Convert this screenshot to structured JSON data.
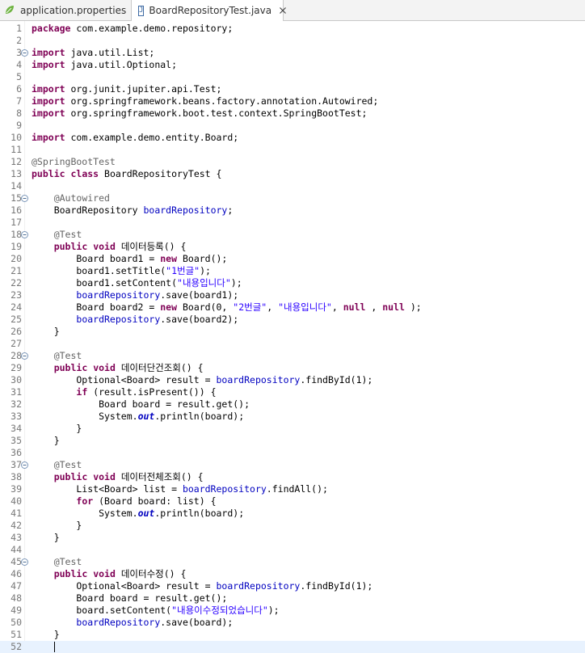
{
  "tabs": [
    {
      "label": "application.properties",
      "icon": "leaf-icon",
      "active": false
    },
    {
      "label": "BoardRepositoryTest.java",
      "icon": "java-file-icon",
      "active": true
    }
  ],
  "colors": {
    "keyword": "#7f0055",
    "annotation": "#646464",
    "string": "#2a00ff",
    "field": "#0000c0",
    "current_line": "#e8f2fe",
    "line_number": "#787878"
  },
  "editor": {
    "current_line": 52,
    "lines": [
      {
        "n": "1",
        "fold": false,
        "tokens": [
          [
            "kw",
            "package"
          ],
          [
            "",
            "com.example.demo.repository;"
          ]
        ]
      },
      {
        "n": "2",
        "fold": false,
        "tokens": []
      },
      {
        "n": "3",
        "fold": true,
        "tokens": [
          [
            "kw",
            "import"
          ],
          [
            "",
            "java.util.List;"
          ]
        ]
      },
      {
        "n": "4",
        "fold": false,
        "tokens": [
          [
            "kw",
            "import"
          ],
          [
            "",
            "java.util.Optional;"
          ]
        ]
      },
      {
        "n": "5",
        "fold": false,
        "tokens": []
      },
      {
        "n": "6",
        "fold": false,
        "tokens": [
          [
            "kw",
            "import"
          ],
          [
            "",
            "org.junit.jupiter.api.Test;"
          ]
        ]
      },
      {
        "n": "7",
        "fold": false,
        "tokens": [
          [
            "kw",
            "import"
          ],
          [
            "",
            "org.springframework.beans.factory.annotation.Autowired;"
          ]
        ]
      },
      {
        "n": "8",
        "fold": false,
        "tokens": [
          [
            "kw",
            "import"
          ],
          [
            "",
            "org.springframework.boot.test.context.SpringBootTest;"
          ]
        ]
      },
      {
        "n": "9",
        "fold": false,
        "tokens": []
      },
      {
        "n": "10",
        "fold": false,
        "tokens": [
          [
            "kw",
            "import"
          ],
          [
            "",
            "com.example.demo.entity.Board;"
          ]
        ]
      },
      {
        "n": "11",
        "fold": false,
        "tokens": []
      },
      {
        "n": "12",
        "fold": false,
        "tokens": [
          [
            "an",
            "@SpringBootTest"
          ]
        ]
      },
      {
        "n": "13",
        "fold": false,
        "tokens": [
          [
            "kw",
            "public"
          ],
          [
            "kw",
            "class"
          ],
          [
            "",
            "BoardRepositoryTest {"
          ]
        ]
      },
      {
        "n": "14",
        "fold": false,
        "tokens": []
      },
      {
        "n": "15",
        "fold": true,
        "tokens": [
          [
            "",
            "    "
          ],
          [
            "an",
            "@Autowired"
          ]
        ]
      },
      {
        "n": "16",
        "fold": false,
        "tokens": [
          [
            "",
            "    BoardRepository "
          ],
          [
            "fd",
            "boardRepository"
          ],
          [
            "",
            ";"
          ]
        ]
      },
      {
        "n": "17",
        "fold": false,
        "tokens": []
      },
      {
        "n": "18",
        "fold": true,
        "tokens": [
          [
            "",
            "    "
          ],
          [
            "an",
            "@Test"
          ]
        ]
      },
      {
        "n": "19",
        "fold": false,
        "tokens": [
          [
            "",
            "    "
          ],
          [
            "kw",
            "public"
          ],
          [
            "kw",
            "void"
          ],
          [
            "",
            "데이터등록() {"
          ]
        ]
      },
      {
        "n": "20",
        "fold": false,
        "tokens": [
          [
            "",
            "        Board board1 = "
          ],
          [
            "kw",
            "new"
          ],
          [
            "",
            "Board();"
          ]
        ]
      },
      {
        "n": "21",
        "fold": false,
        "tokens": [
          [
            "",
            "        board1.setTitle("
          ],
          [
            "st",
            "\"1번글\""
          ],
          [
            "",
            ");"
          ]
        ]
      },
      {
        "n": "22",
        "fold": false,
        "tokens": [
          [
            "",
            "        board1.setContent("
          ],
          [
            "st",
            "\"내용입니다\""
          ],
          [
            "",
            ");"
          ]
        ]
      },
      {
        "n": "23",
        "fold": false,
        "tokens": [
          [
            "",
            "        "
          ],
          [
            "fd",
            "boardRepository"
          ],
          [
            "",
            ".save(board1);"
          ]
        ]
      },
      {
        "n": "24",
        "fold": false,
        "tokens": [
          [
            "",
            "        Board board2 = "
          ],
          [
            "kw",
            "new"
          ],
          [
            "",
            "Board(0, "
          ],
          [
            "st",
            "\"2번글\""
          ],
          [
            "",
            ", "
          ],
          [
            "st",
            "\"내용입니다\""
          ],
          [
            "",
            ", "
          ],
          [
            "kw",
            "null"
          ],
          [
            "",
            ", "
          ],
          [
            "kw",
            "null"
          ],
          [
            "",
            ");"
          ]
        ]
      },
      {
        "n": "25",
        "fold": false,
        "tokens": [
          [
            "",
            "        "
          ],
          [
            "fd",
            "boardRepository"
          ],
          [
            "",
            ".save(board2);"
          ]
        ]
      },
      {
        "n": "26",
        "fold": false,
        "tokens": [
          [
            "",
            "    }"
          ]
        ]
      },
      {
        "n": "27",
        "fold": false,
        "tokens": []
      },
      {
        "n": "28",
        "fold": true,
        "tokens": [
          [
            "",
            "    "
          ],
          [
            "an",
            "@Test"
          ]
        ]
      },
      {
        "n": "29",
        "fold": false,
        "tokens": [
          [
            "",
            "    "
          ],
          [
            "kw",
            "public"
          ],
          [
            "kw",
            "void"
          ],
          [
            "",
            "데이터단건조회() {"
          ]
        ]
      },
      {
        "n": "30",
        "fold": false,
        "tokens": [
          [
            "",
            "        Optional<Board> result = "
          ],
          [
            "fd",
            "boardRepository"
          ],
          [
            "",
            ".findById(1);"
          ]
        ]
      },
      {
        "n": "31",
        "fold": false,
        "tokens": [
          [
            "",
            "        "
          ],
          [
            "kw",
            "if"
          ],
          [
            "",
            "(result.isPresent()) {"
          ]
        ]
      },
      {
        "n": "32",
        "fold": false,
        "tokens": [
          [
            "",
            "            Board board = result.get();"
          ]
        ]
      },
      {
        "n": "33",
        "fold": false,
        "tokens": [
          [
            "",
            "            System."
          ],
          [
            "sf",
            "out"
          ],
          [
            "",
            ".println(board);"
          ]
        ]
      },
      {
        "n": "34",
        "fold": false,
        "tokens": [
          [
            "",
            "        }"
          ]
        ]
      },
      {
        "n": "35",
        "fold": false,
        "tokens": [
          [
            "",
            "    }"
          ]
        ]
      },
      {
        "n": "36",
        "fold": false,
        "tokens": []
      },
      {
        "n": "37",
        "fold": true,
        "tokens": [
          [
            "",
            "    "
          ],
          [
            "an",
            "@Test"
          ]
        ]
      },
      {
        "n": "38",
        "fold": false,
        "tokens": [
          [
            "",
            "    "
          ],
          [
            "kw",
            "public"
          ],
          [
            "kw",
            "void"
          ],
          [
            "",
            "데이터전체조회() {"
          ]
        ]
      },
      {
        "n": "39",
        "fold": false,
        "tokens": [
          [
            "",
            "        List<Board> list = "
          ],
          [
            "fd",
            "boardRepository"
          ],
          [
            "",
            ".findAll();"
          ]
        ]
      },
      {
        "n": "40",
        "fold": false,
        "tokens": [
          [
            "",
            "        "
          ],
          [
            "kw",
            "for"
          ],
          [
            "",
            "(Board board: list) {"
          ]
        ]
      },
      {
        "n": "41",
        "fold": false,
        "tokens": [
          [
            "",
            "            System."
          ],
          [
            "sf",
            "out"
          ],
          [
            "",
            ".println(board);"
          ]
        ]
      },
      {
        "n": "42",
        "fold": false,
        "tokens": [
          [
            "",
            "        }"
          ]
        ]
      },
      {
        "n": "43",
        "fold": false,
        "tokens": [
          [
            "",
            "    }"
          ]
        ]
      },
      {
        "n": "44",
        "fold": false,
        "tokens": []
      },
      {
        "n": "45",
        "fold": true,
        "tokens": [
          [
            "",
            "    "
          ],
          [
            "an",
            "@Test"
          ]
        ]
      },
      {
        "n": "46",
        "fold": false,
        "tokens": [
          [
            "",
            "    "
          ],
          [
            "kw",
            "public"
          ],
          [
            "kw",
            "void"
          ],
          [
            "",
            "데이터수정() {"
          ]
        ]
      },
      {
        "n": "47",
        "fold": false,
        "tokens": [
          [
            "",
            "        Optional<Board> result = "
          ],
          [
            "fd",
            "boardRepository"
          ],
          [
            "",
            ".findById(1);"
          ]
        ]
      },
      {
        "n": "48",
        "fold": false,
        "tokens": [
          [
            "",
            "        Board board = result.get();"
          ]
        ]
      },
      {
        "n": "49",
        "fold": false,
        "tokens": [
          [
            "",
            "        board.setContent("
          ],
          [
            "st",
            "\"내용이수정되었습니다\""
          ],
          [
            "",
            ");"
          ]
        ]
      },
      {
        "n": "50",
        "fold": false,
        "tokens": [
          [
            "",
            "        "
          ],
          [
            "fd",
            "boardRepository"
          ],
          [
            "",
            ".save(board);"
          ]
        ]
      },
      {
        "n": "51",
        "fold": false,
        "tokens": [
          [
            "",
            "    }"
          ]
        ]
      },
      {
        "n": "52",
        "fold": false,
        "tokens": []
      }
    ]
  }
}
